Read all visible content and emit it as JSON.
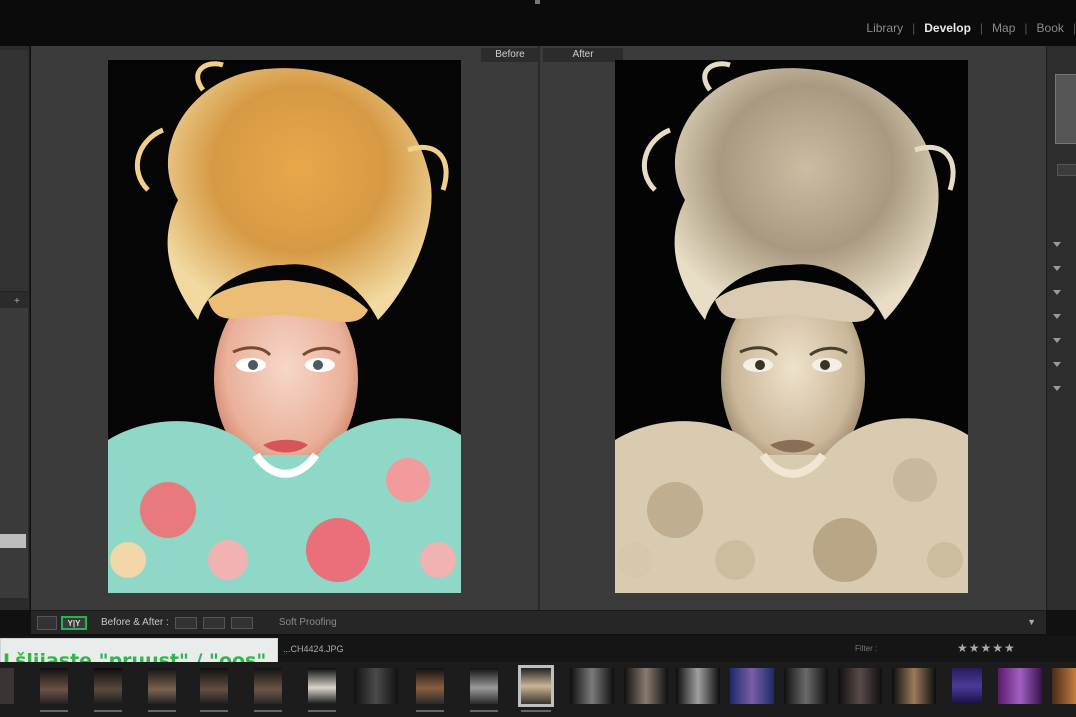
{
  "top_bar": {
    "modules": [
      {
        "label": "Library",
        "active": false
      },
      {
        "label": "Develop",
        "active": true
      },
      {
        "label": "Map",
        "active": false
      },
      {
        "label": "Book",
        "active": false
      }
    ]
  },
  "view": {
    "before_label": "Before",
    "after_label": "After"
  },
  "toolbar": {
    "yy_button": "Y|Y",
    "before_after_label": "Before & After :",
    "soft_proofing_label": "Soft Proofing"
  },
  "filmstrip_header": {
    "filename": "...CH4424.JPG",
    "filter_label": "Filter :",
    "stars": "★★★★★"
  },
  "annotation": {
    "text": "Lšlijaste \"pruust\" / \"oos\""
  },
  "colors": {
    "accent_green": "#25b64a",
    "panel_bg": "#3b3b3b",
    "top_bar_bg": "#0b0b0b"
  }
}
